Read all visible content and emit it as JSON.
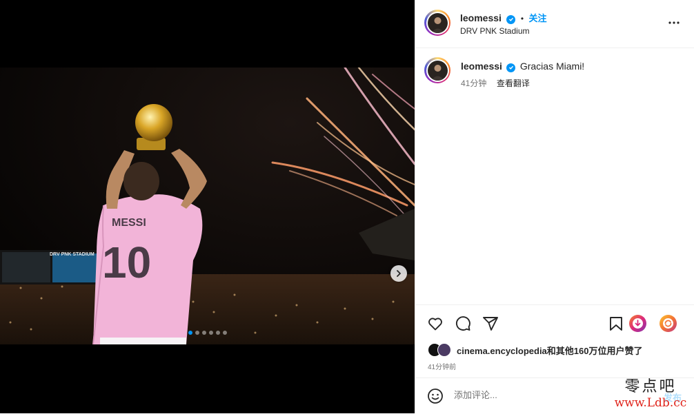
{
  "post": {
    "username": "leomessi",
    "follow_label": "关注",
    "separator": "•",
    "location": "DRV PNK Stadium"
  },
  "caption": {
    "username": "leomessi",
    "text": "Gracias Miami!",
    "time": "41分钟",
    "translate_label": "查看翻译"
  },
  "photo": {
    "jersey_name": "MESSI",
    "jersey_number": "10",
    "stadium_board": "DRV PNK STADIUM",
    "carousel_count": 6,
    "carousel_active": 1
  },
  "likes": {
    "text": "cinema.encyclopedia和其他160万位用户赞了",
    "time": "41分钟前"
  },
  "comment": {
    "placeholder": "添加评论...",
    "post_label": "发布"
  },
  "watermark": {
    "chinese": "零点吧",
    "url": "www.Ldb.cc"
  },
  "icons": [
    "more-icon",
    "verified-icon",
    "heart-icon",
    "comment-icon",
    "share-icon",
    "bookmark-icon",
    "chevron-right-icon",
    "emoji-icon"
  ],
  "colors": {
    "accent": "#0095f6",
    "text": "#262626",
    "muted": "#737373",
    "jersey_pink": "#f2b4d8",
    "watermark_red": "#e0241b"
  }
}
